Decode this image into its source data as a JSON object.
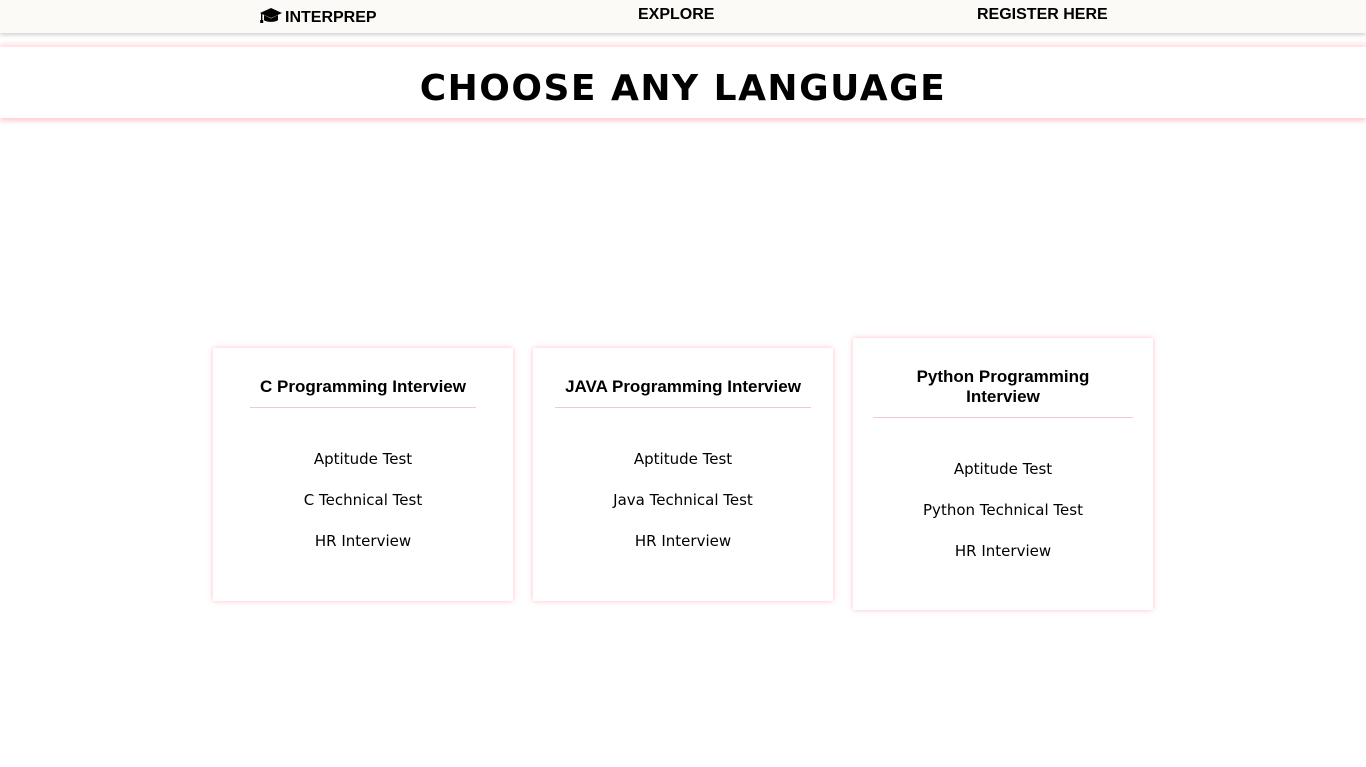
{
  "navbar": {
    "brand_icon": "graduation-cap-icon",
    "brand": "INTERPREP",
    "explore": "EXPLORE",
    "register": "REGISTER HERE"
  },
  "header": {
    "title": "CHOOSE ANY LANGUAGE"
  },
  "cards": [
    {
      "title": "C Programming Interview",
      "links": [
        "Aptitude Test",
        "C Technical Test",
        "HR Interview"
      ]
    },
    {
      "title": "JAVA Programming Interview",
      "links": [
        "Aptitude Test",
        "Java Technical Test",
        "HR Interview"
      ]
    },
    {
      "title": "Python Programming Interview",
      "links": [
        "Aptitude Test",
        "Python Technical Test",
        "HR Interview"
      ]
    }
  ],
  "colors": {
    "navbar_bg": "#fbfaf7",
    "accent_pink": "#f2c9cf",
    "text": "#000000"
  }
}
